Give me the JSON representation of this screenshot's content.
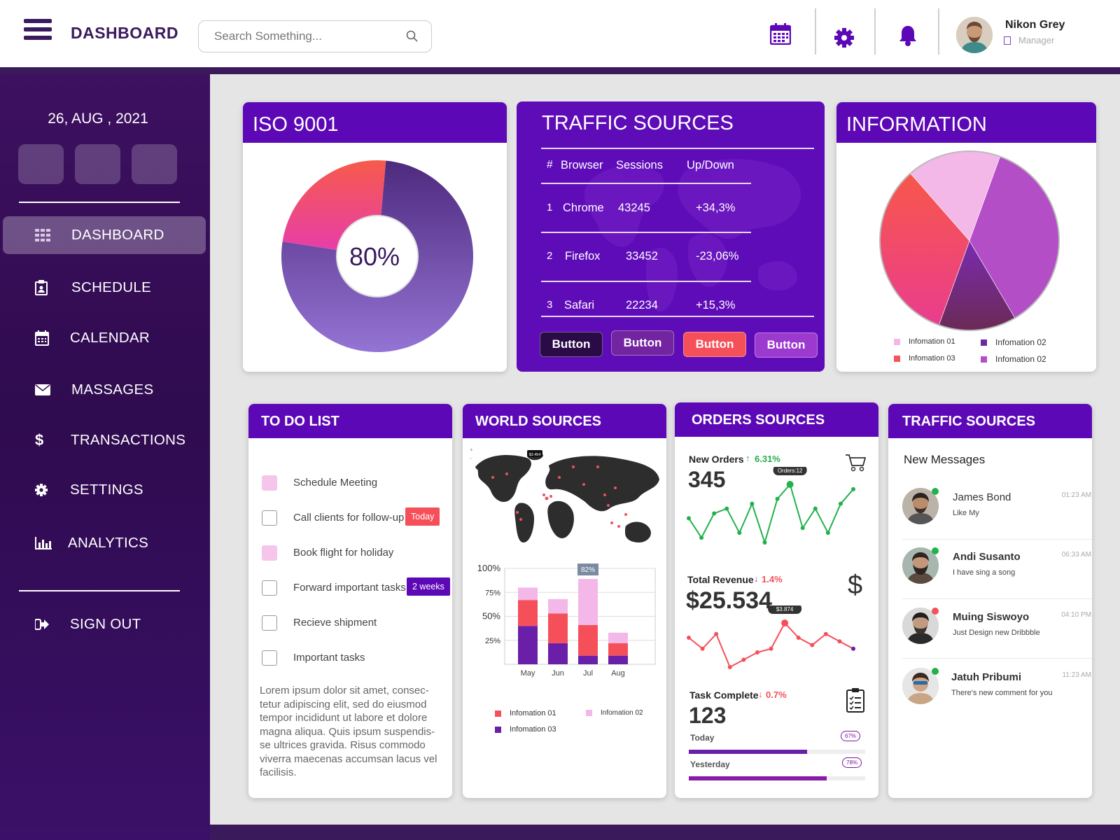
{
  "header": {
    "title": "DASHBOARD",
    "search_placeholder": "Search Something...",
    "user_name": "Nikon Grey",
    "user_role": "Manager"
  },
  "sidebar": {
    "date": "26, AUG , 2021",
    "items": [
      {
        "label": "DASHBOARD",
        "icon": "grid-icon",
        "active": true
      },
      {
        "label": "SCHEDULE",
        "icon": "schedule-icon"
      },
      {
        "label": "CALENDAR",
        "icon": "calendar-icon"
      },
      {
        "label": "MASSAGES",
        "icon": "envelope-icon"
      },
      {
        "label": "TRANSACTIONS",
        "icon": "dollar-icon"
      },
      {
        "label": "SETTINGS",
        "icon": "gear-icon"
      },
      {
        "label": "ANALYTICS",
        "icon": "bar-chart-icon"
      }
    ],
    "signout": "SIGN OUT"
  },
  "iso": {
    "title": "ISO 9001",
    "center": "80%"
  },
  "traffic": {
    "title": "TRAFFIC SOURCES",
    "headers": [
      "#",
      "Browser",
      "Sessions",
      "Up/Down"
    ],
    "rows": [
      [
        "1",
        "Chrome",
        "43245",
        "+34,3%"
      ],
      [
        "2",
        "Firefox",
        "33452",
        "-23,06%"
      ],
      [
        "3",
        "Safari",
        "22234",
        "+15,3%"
      ]
    ],
    "buttons": [
      "Button",
      "Button",
      "Button",
      "Button"
    ]
  },
  "information": {
    "title": "INFORMATION",
    "legend": [
      "Infomation 01",
      "Infomation 02",
      "Infomation 03",
      "Infomation 02"
    ]
  },
  "todo": {
    "title": "TO DO LIST",
    "items": [
      {
        "text": "Schedule Meeting",
        "checked": true
      },
      {
        "text": "Call clients for follow-up",
        "checked": false,
        "tag": "Today"
      },
      {
        "text": "Book flight for holiday",
        "checked": true
      },
      {
        "text": "Forward important tasks",
        "checked": false,
        "tag": "2 weeks"
      },
      {
        "text": "Recieve shipment",
        "checked": false
      },
      {
        "text": "Important tasks",
        "checked": false
      }
    ],
    "paragraph": "Lorem ipsum dolor sit amet, consec-tetur adipiscing elit, sed do eiusmod tempor incididunt ut labore et dolore magna aliqua. Quis ipsum suspendis-se ultrices gravida. Risus commodo viverra maecenas accumsan lacus vel facilisis."
  },
  "world": {
    "title": "WORLD SOURCES",
    "map_badge": "$3.454",
    "bar_tooltip": "82%",
    "legend": [
      "Infomation 01",
      "Infomation 02",
      "Infomation 03"
    ]
  },
  "orders": {
    "title": "ORDERS SOURCES",
    "new_orders": {
      "label": "New Orders",
      "change": "6.31%",
      "value": "345",
      "tooltip": "Orders:12"
    },
    "revenue": {
      "label": "Total Revenue",
      "change": "1.4%",
      "value": "$25.534",
      "tooltip": "$3.874"
    },
    "tasks": {
      "label": "Task Complete",
      "change": "0.7%",
      "value": "123",
      "today_label": "Today",
      "today_pct": "67%",
      "today_value": 0.67,
      "yesterday_label": "Yesterday",
      "yesterday_pct": "78%",
      "yesterday_value": 0.78
    }
  },
  "messages": {
    "title": "TRAFFIC SOURCES",
    "subtitle": "New Messages",
    "items": [
      {
        "name": "James Bond",
        "text": "Like My",
        "time": "01:23 AM"
      },
      {
        "name": "Andi Susanto",
        "text": "I have sing a song",
        "time": "06:33 AM"
      },
      {
        "name": "Muing Siswoyo",
        "text": "Just Design new Dribbble",
        "time": "04:10 PM"
      },
      {
        "name": "Jatuh Pribumi",
        "text": "There's new comment for you",
        "time": "11:23 AM"
      }
    ]
  },
  "chart_data": [
    {
      "type": "pie",
      "title": "ISO 9001",
      "center_label": "80%",
      "slices": [
        {
          "value": 0.76,
          "color": "#7e58c0"
        },
        {
          "value": 0.24,
          "color": "#f0506e"
        }
      ]
    },
    {
      "type": "pie",
      "title": "INFORMATION",
      "categories": [
        "Infomation 01",
        "Infomation 02",
        "Infomation 03",
        "Infomation 02"
      ],
      "values": [
        17,
        14,
        33,
        36
      ],
      "colors": [
        "#f3b7e8",
        "#6a2aa0",
        "#f5555a",
        "#b34ec6"
      ]
    },
    {
      "type": "bar",
      "stacked": true,
      "categories": [
        "May",
        "Jun",
        "Jul",
        "Aug"
      ],
      "yticks": [
        "25%",
        "50%",
        "75%",
        "100%"
      ],
      "ylim": [
        0,
        100
      ],
      "series": [
        {
          "name": "Infomation 03",
          "values": [
            40,
            22,
            9,
            9
          ]
        },
        {
          "name": "Infomation 01",
          "values": [
            27,
            31,
            32,
            13
          ]
        },
        {
          "name": "Infomation 02",
          "values": [
            13,
            15,
            48,
            11
          ]
        }
      ]
    },
    {
      "type": "line",
      "title": "New Orders",
      "values": [
        6,
        2,
        7,
        8,
        3,
        9,
        1,
        10,
        13,
        4,
        8,
        3,
        9,
        12
      ]
    },
    {
      "type": "line",
      "title": "Total Revenue",
      "values": [
        10,
        7,
        11,
        2,
        4,
        6,
        7,
        14,
        10,
        8,
        11,
        9,
        7
      ]
    }
  ],
  "colors": {
    "purple": "#5d08b6",
    "sidebar": "#35104f",
    "red": "#f5505a",
    "pink": "#f3b7e8",
    "green": "#22b14c"
  }
}
